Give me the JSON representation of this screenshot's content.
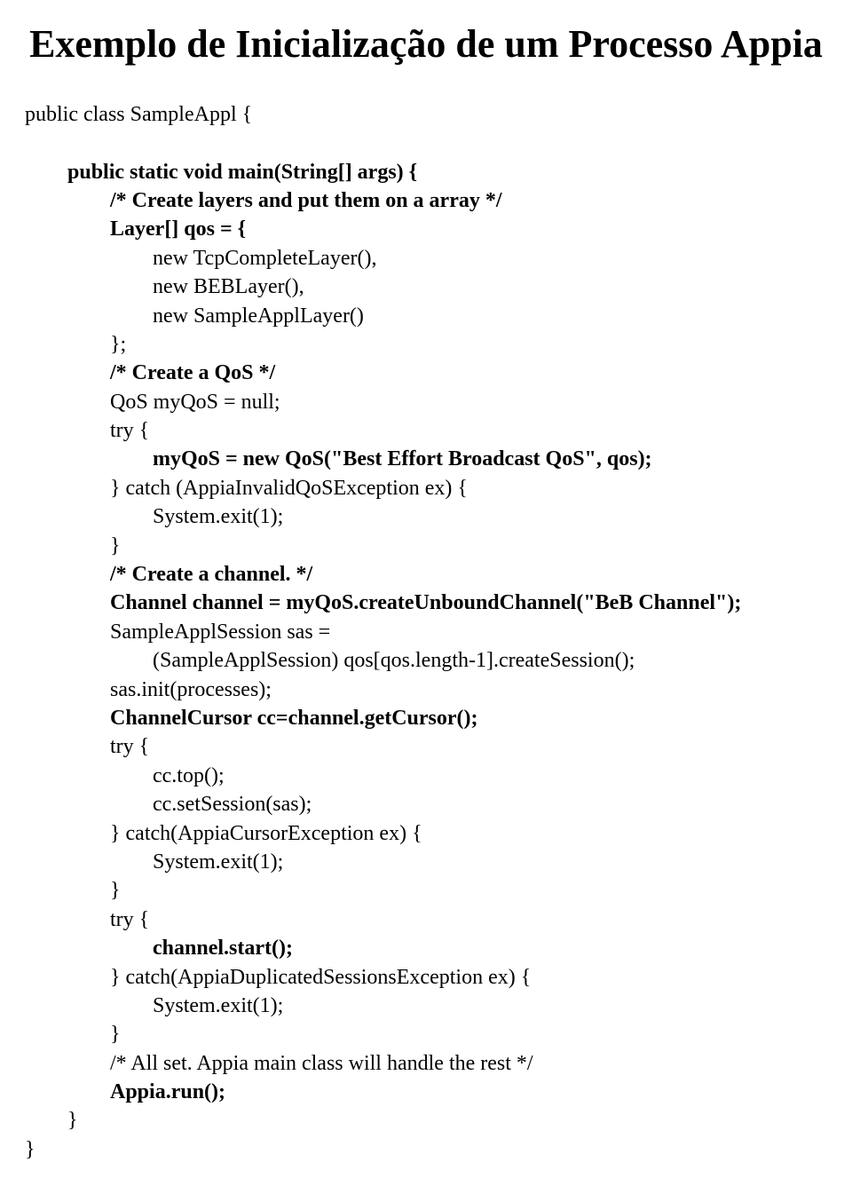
{
  "title": "Exemplo de Inicialização de um Processo Appia",
  "lines": [
    {
      "indent": 0,
      "bold": false,
      "text": "public class SampleAppl {"
    },
    {
      "indent": 0,
      "bold": false,
      "text": ""
    },
    {
      "indent": 1,
      "bold": true,
      "text": "public static void main(String[] args) {"
    },
    {
      "indent": 2,
      "bold": true,
      "text": "/* Create layers and put them on a array */"
    },
    {
      "indent": 2,
      "bold": true,
      "text": "Layer[] qos = {"
    },
    {
      "indent": 3,
      "bold": false,
      "text": "new TcpCompleteLayer(),"
    },
    {
      "indent": 3,
      "bold": false,
      "text": "new BEBLayer(),"
    },
    {
      "indent": 3,
      "bold": false,
      "text": "new SampleApplLayer()"
    },
    {
      "indent": 2,
      "bold": false,
      "text": "};"
    },
    {
      "indent": 2,
      "bold": true,
      "text": "/* Create a QoS */"
    },
    {
      "indent": 2,
      "bold": false,
      "text": "QoS myQoS = null;"
    },
    {
      "indent": 2,
      "bold": false,
      "text": "try {"
    },
    {
      "indent": 3,
      "bold": true,
      "text": "myQoS = new QoS(\"Best Effort Broadcast QoS\", qos);"
    },
    {
      "indent": 2,
      "bold": false,
      "text": "} catch (AppiaInvalidQoSException ex) {"
    },
    {
      "indent": 3,
      "bold": false,
      "text": "System.exit(1);"
    },
    {
      "indent": 2,
      "bold": false,
      "text": "}"
    },
    {
      "indent": 2,
      "bold": true,
      "text": "/* Create a channel. */"
    },
    {
      "indent": 2,
      "bold": true,
      "text": "Channel channel = myQoS.createUnboundChannel(\"BeB Channel\");"
    },
    {
      "indent": 2,
      "bold": false,
      "text": "SampleApplSession sas ="
    },
    {
      "indent": 3,
      "bold": false,
      "text": "(SampleApplSession) qos[qos.length-1].createSession();"
    },
    {
      "indent": 2,
      "bold": false,
      "text": "sas.init(processes);"
    },
    {
      "indent": 2,
      "bold": true,
      "text": "ChannelCursor cc=channel.getCursor();"
    },
    {
      "indent": 2,
      "bold": false,
      "text": "try {"
    },
    {
      "indent": 3,
      "bold": false,
      "text": "cc.top();"
    },
    {
      "indent": 3,
      "bold": false,
      "text": "cc.setSession(sas);"
    },
    {
      "indent": 2,
      "bold": false,
      "text": "} catch(AppiaCursorException ex) {"
    },
    {
      "indent": 3,
      "bold": false,
      "text": "System.exit(1);"
    },
    {
      "indent": 2,
      "bold": false,
      "text": "}"
    },
    {
      "indent": 2,
      "bold": false,
      "text": "try {"
    },
    {
      "indent": 3,
      "bold": true,
      "text": "channel.start();"
    },
    {
      "indent": 2,
      "bold": false,
      "text": "} catch(AppiaDuplicatedSessionsException ex) {"
    },
    {
      "indent": 3,
      "bold": false,
      "text": "System.exit(1);"
    },
    {
      "indent": 2,
      "bold": false,
      "text": "}"
    },
    {
      "indent": 2,
      "bold": false,
      "text": "/* All set. Appia main class will handle the rest */"
    },
    {
      "indent": 2,
      "bold": true,
      "text": "Appia.run();"
    },
    {
      "indent": 1,
      "bold": false,
      "text": "}"
    },
    {
      "indent": 0,
      "bold": false,
      "text": "}"
    }
  ],
  "indent_unit": "        "
}
